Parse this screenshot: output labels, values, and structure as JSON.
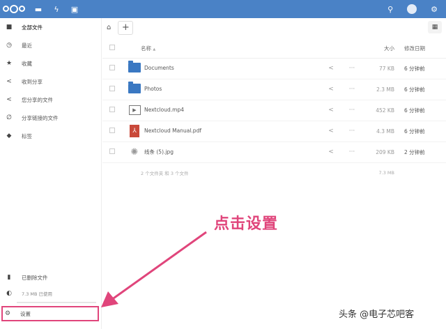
{
  "header": {
    "icons": [
      "nextcloud-logo",
      "files-icon",
      "activity-icon",
      "gallery-icon"
    ],
    "right_icons": [
      "search-icon",
      "contacts-icon",
      "settings-icon"
    ]
  },
  "sidebar": {
    "items": [
      {
        "label": "全部文件",
        "icon": "folder-icon"
      },
      {
        "label": "最近",
        "icon": "clock-icon"
      },
      {
        "label": "收藏",
        "icon": "star-icon"
      },
      {
        "label": "收到分享",
        "icon": "share-icon"
      },
      {
        "label": "您分享的文件",
        "icon": "share-icon"
      },
      {
        "label": "分享链接的文件",
        "icon": "link-icon"
      },
      {
        "label": "标签",
        "icon": "tag-icon"
      }
    ],
    "deleted": "已删除文件",
    "quota": "7.3 MB 已使用",
    "quota_fraction": 0.0,
    "settings": "设置"
  },
  "table": {
    "headers": {
      "name": "名称",
      "sort": "▲",
      "size": "大小",
      "modified": "修改日期"
    },
    "rows": [
      {
        "name": "Documents",
        "type": "folder",
        "size": "77 KB",
        "modified": "6 分钟前"
      },
      {
        "name": "Photos",
        "type": "folder",
        "size": "2.3 MB",
        "modified": "6 分钟前"
      },
      {
        "name": "Nextcloud.mp4",
        "type": "video",
        "size": "452 KB",
        "modified": "6 分钟前"
      },
      {
        "name": "Nextcloud Manual.pdf",
        "type": "pdf",
        "size": "4.3 MB",
        "modified": "6 分钟前"
      },
      {
        "name": "线条 (5).jpg",
        "type": "image",
        "size": "209 KB",
        "modified": "2 分钟前"
      }
    ],
    "summary": "2 个文件夹 和 3 个文件",
    "total_size": "7.3 MB"
  },
  "annotation": "点击设置",
  "accent": "#e0457b",
  "watermark": "头条 @电子芯吧客"
}
